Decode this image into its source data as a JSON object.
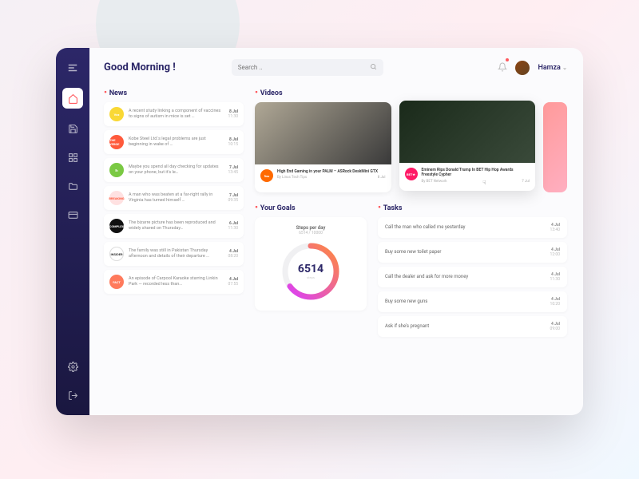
{
  "header": {
    "greeting": "Good Morning !",
    "search_placeholder": "Search ..",
    "username": "Hamza"
  },
  "sections": {
    "news": "News",
    "videos": "Videos",
    "goals": "Your Goals",
    "tasks": "Tasks"
  },
  "news": [
    {
      "badge": "Vox",
      "color": "#f9d835",
      "text": "A recent study linking a component of vaccines to signs of autism in mice is set …",
      "date": "8 Jul",
      "time": "11:30"
    },
    {
      "badge": "THE VERGE",
      "color": "#ff5a3c",
      "text": "Kobe Steel Ltd.'s legal problems are just beginning in wake of …",
      "date": "8 Jul",
      "time": "10:15"
    },
    {
      "badge": "lh",
      "color": "#7ac943",
      "text": "Maybe you spend all day checking for updates on your phone, but it's le…",
      "date": "7 Jul",
      "time": "13:45"
    },
    {
      "badge": "BREAKING",
      "color": "#ffe1e1",
      "text": "A man who was beaten at a far-right rally in Virginia has turned himself …",
      "date": "7 Jul",
      "time": "09:35",
      "tcolor": "#ff5a3c"
    },
    {
      "badge": "COMPLEX",
      "color": "#111",
      "text": "The bizarre picture has been reproduced and widely shared on Thursday…",
      "date": "6 Jul",
      "time": "11:30"
    },
    {
      "badge": "INSIDER",
      "color": "#fff",
      "text": "The family was still in Pakistan Thursday afternoon and details of their departure …",
      "date": "4 Jul",
      "time": "08:20",
      "tcolor": "#333",
      "border": "1px solid #ddd"
    },
    {
      "badge": "FACT",
      "color": "#ff7a5c",
      "text": "An episode of Carpool Karaoke starring Linkin Park — recorded less than…",
      "date": "4 Jul",
      "time": "07:55"
    }
  ],
  "videos": [
    {
      "badge": "linus tech tips",
      "color": "#ff6a00",
      "title": "High End Gaming in your PALM – ASRock DeskMini GTX",
      "by": "By Linus Tech Tips",
      "date": "8 Jul"
    },
    {
      "badge": "BET★",
      "color": "#ff1a66",
      "title": "Eminem Rips Donald Trump In BET Hip Hop Awards Freestyle Cypher",
      "by": "By BET Network",
      "date": "7 Jul"
    }
  ],
  "goals": {
    "label": "Steps per day",
    "sub": "6514 / 10000",
    "value": "6514",
    "progress": 0.65
  },
  "tasks": [
    {
      "text": "Call the man who called me yesterday",
      "date": "4 Jul",
      "time": "13:40"
    },
    {
      "text": "Buy some new toilet paper",
      "date": "4 Jul",
      "time": "12:00"
    },
    {
      "text": "Call the dealer and ask for more money",
      "date": "4 Jul",
      "time": "11:30"
    },
    {
      "text": "Buy some new guns",
      "date": "4 Jul",
      "time": "10:20"
    },
    {
      "text": "Ask if she's pregnant",
      "date": "4 Jul",
      "time": "09:00"
    }
  ]
}
